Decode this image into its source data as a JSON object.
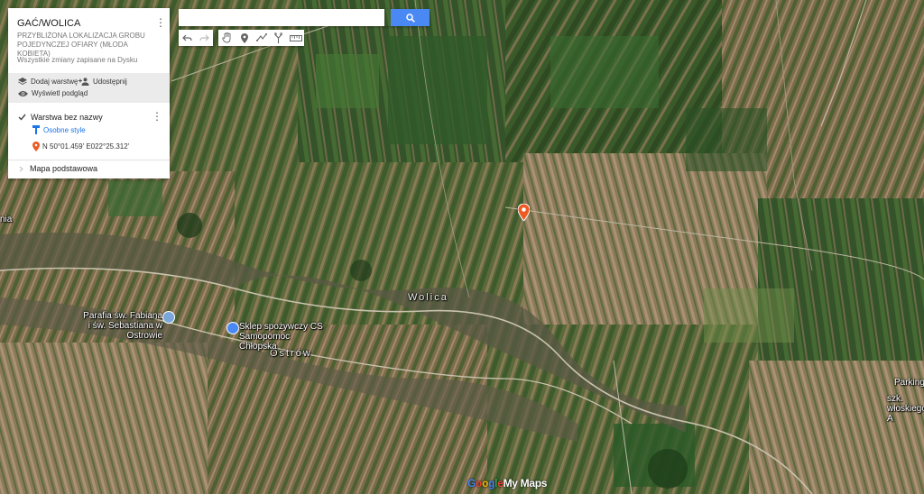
{
  "panel": {
    "title": "GAĆ/WOLICA",
    "subtitle": "PRZYBLIŻONA LOKALIZACJA GROBU POJEDYNCZEJ OFIARY (MŁODA KOBIETA)",
    "saved_status": "Wszystkie zmiany zapisane na Dysku",
    "add_layer_label": "Dodaj warstwę",
    "share_label": "Udostępnij",
    "preview_label": "Wyświetl podgląd",
    "layer_name": "Warstwa bez nazwy",
    "layer_checked": true,
    "style_link": "Osobne style",
    "placemark_coords": "N 50°01.459' E022°25.312'",
    "basemap_label": "Mapa podstawowa"
  },
  "search": {
    "placeholder": "",
    "button_icon": "search-icon"
  },
  "toolbar": {
    "history": [
      "undo-icon",
      "redo-icon"
    ],
    "tools": [
      "hand-icon",
      "marker-icon",
      "draw-line-icon",
      "directions-icon",
      "ruler-icon"
    ]
  },
  "map_labels": {
    "village_wolica": "Wolica",
    "village_ostrow": "Ostrów",
    "church": "Parafia św. Fabiana i św. Sebastiana w Ostrowie",
    "shop": "Sklep spożywczy CS Samopomoc Chłopska",
    "parking": "Parking",
    "edge_right": "szk. włoskiego A",
    "edge_left": "nia"
  },
  "attribution": {
    "g1": "G",
    "g2": "o",
    "g3": "o",
    "g4": "g",
    "g5": "l",
    "g6": "e",
    "product": "My Maps"
  },
  "colors": {
    "accent_blue": "#4a89f3",
    "placemark": "#ee5a24",
    "link_blue": "#1a73e8"
  }
}
